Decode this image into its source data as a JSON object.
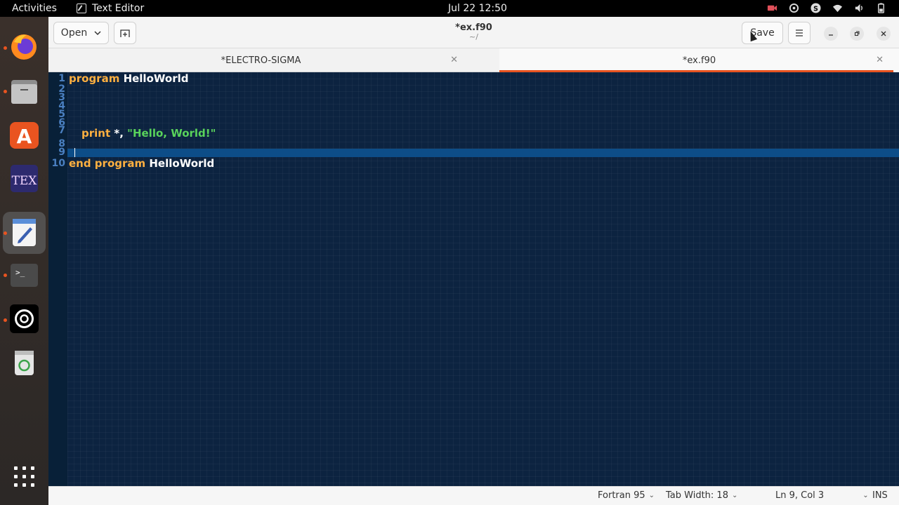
{
  "topbar": {
    "activities": "Activities",
    "app_name": "Text Editor",
    "clock": "Jul 22  12:50"
  },
  "headerbar": {
    "open_label": "Open",
    "save_label": "Save",
    "title": "*ex.f90",
    "subtitle": "~/"
  },
  "tabs": [
    {
      "label": "*ELECTRO-SIGMA",
      "active": false
    },
    {
      "label": "*ex.f90",
      "active": true
    }
  ],
  "editor": {
    "line_numbers": [
      "1",
      "2",
      "3",
      "4",
      "5",
      "6",
      "7",
      "8",
      "9",
      "10"
    ],
    "line1_kw": "program",
    "line1_name": "HelloWorld",
    "line7_kw": "print",
    "line7_mid": " *, ",
    "line7_str": "\"Hello, World!\"",
    "line10_kw": "end program",
    "line10_name": "HelloWorld"
  },
  "statusbar": {
    "language": "Fortran 95",
    "tab_width": "Tab Width: 18",
    "position": "Ln 9, Col 3",
    "mode": "INS"
  },
  "colors": {
    "accent": "#e95420",
    "editor_bg": "#0c2340",
    "keyword": "#ffb040",
    "string": "#59d35b",
    "line_number": "#4a7fc0"
  }
}
